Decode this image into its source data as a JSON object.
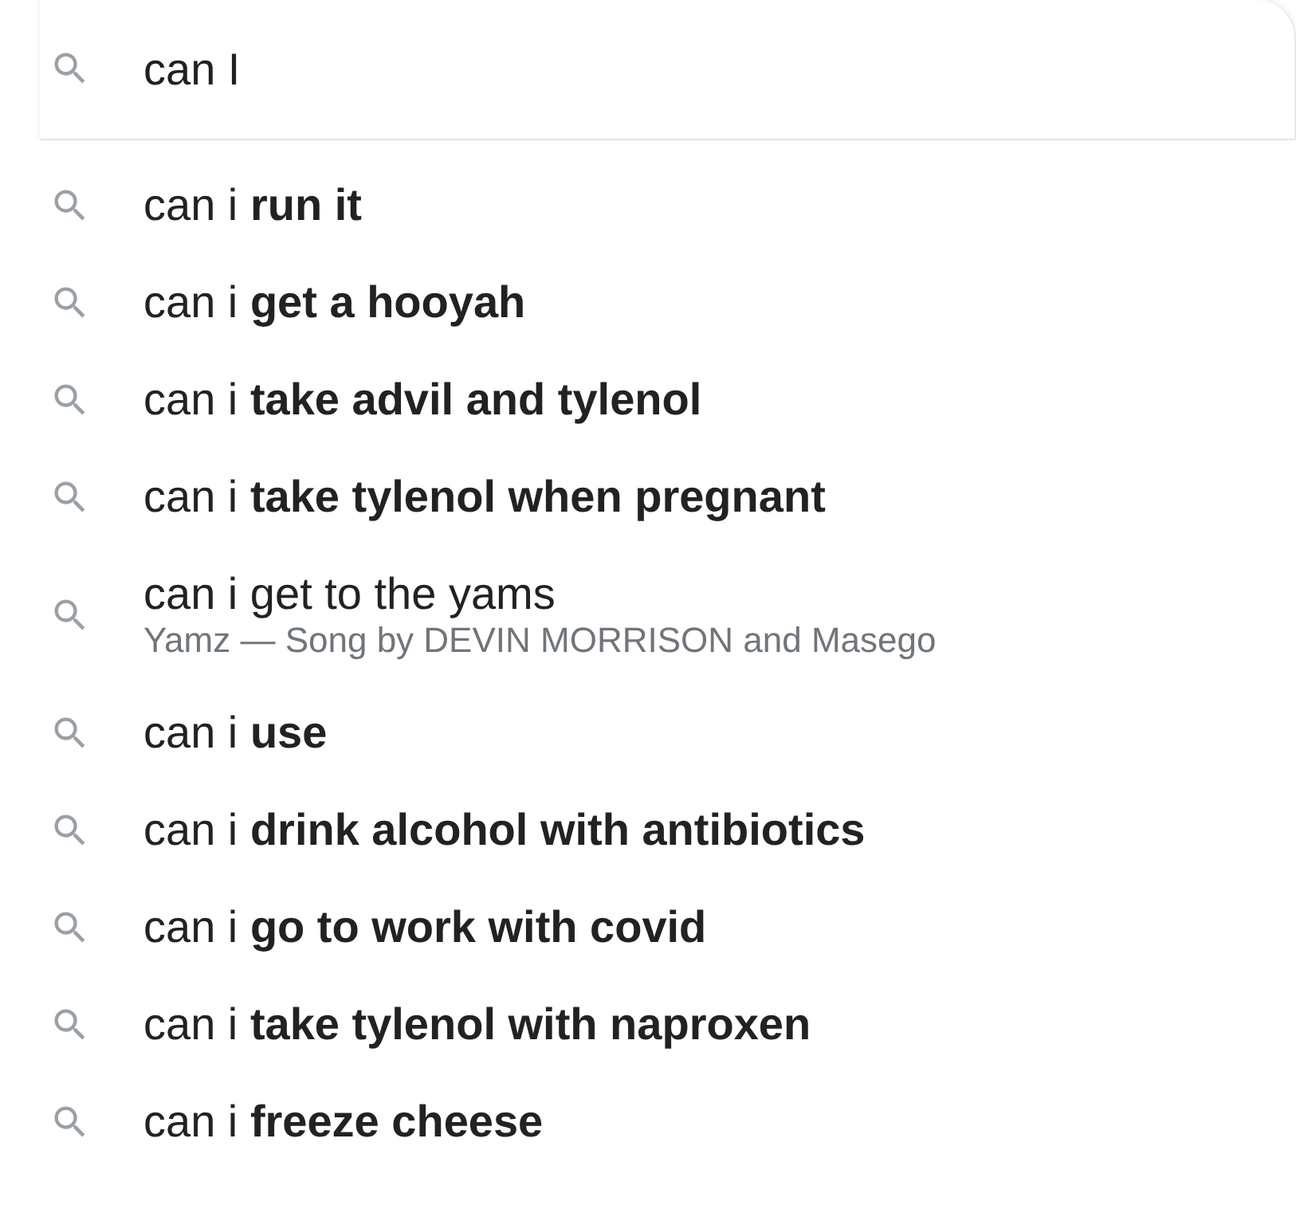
{
  "search": {
    "value": "can I"
  },
  "suggestions": [
    {
      "text": "can i **run it**"
    },
    {
      "text": "can i **get a hooyah**"
    },
    {
      "text": "can i **take advil and tylenol**"
    },
    {
      "text": "can i **take tylenol when pregnant**"
    },
    {
      "text": "can i get to the yams",
      "subtitle": "Yamz — Song by DEVIN MORRISON and Masego"
    },
    {
      "text": "can i **use**"
    },
    {
      "text": "can i **drink alcohol with antibiotics**"
    },
    {
      "text": "can i **go to work with covid**"
    },
    {
      "text": "can i **take tylenol with naproxen**"
    },
    {
      "text": "can i **freeze cheese**"
    }
  ]
}
